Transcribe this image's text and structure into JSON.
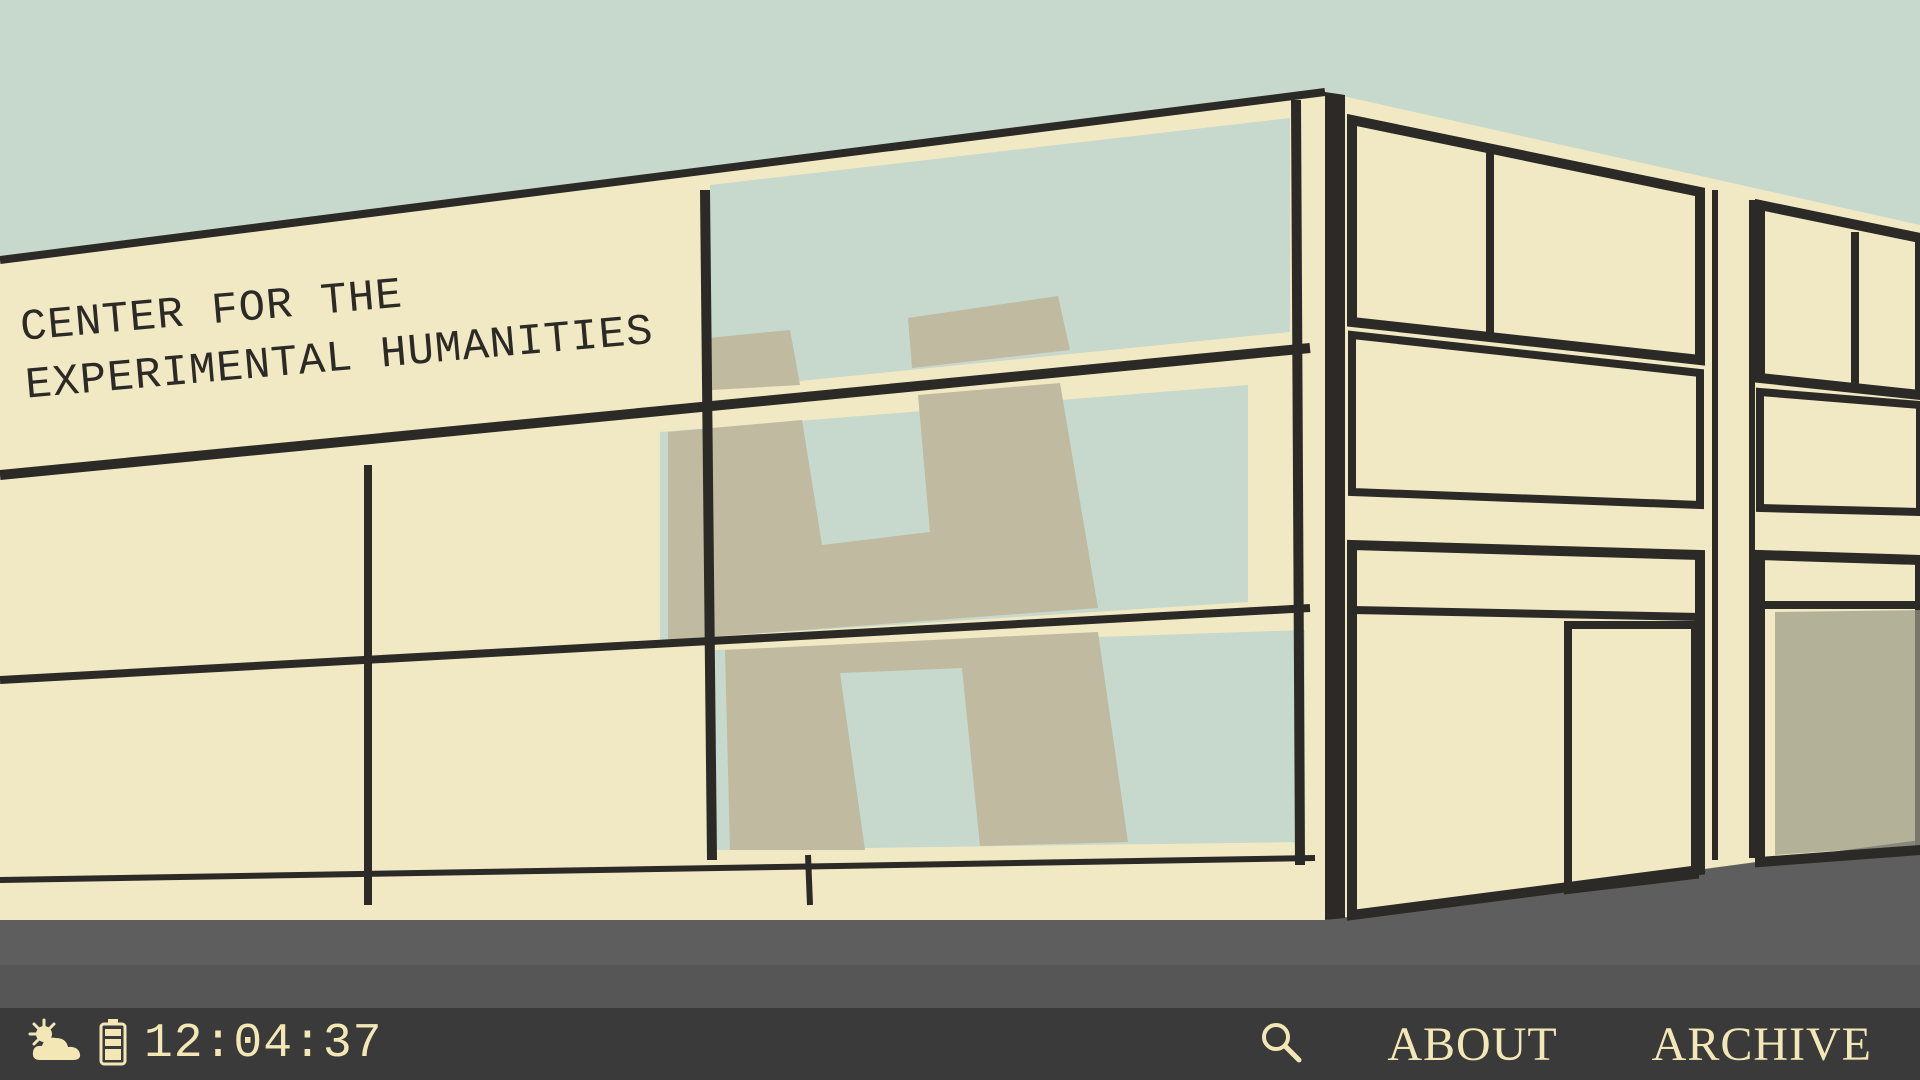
{
  "sign": {
    "line1": "CENTER FOR THE",
    "line2": "EXPERIMENTAL HUMANITIES"
  },
  "taskbar": {
    "time": "12:04:37",
    "weather_icon": "partly-cloudy-icon",
    "battery_icon": "battery-icon",
    "search_icon": "search-icon"
  },
  "nav": {
    "about": "ABOUT",
    "archive": "ARCHIVE"
  },
  "colors": {
    "sky": "#c7d8cc",
    "facade": "#f1e9c3",
    "taupe": "#bfbaa0",
    "ink": "#2b2a26",
    "road": "#5e5e5e",
    "taskbar": "#3a3a3a",
    "taskbar_text": "#f3e8b5"
  }
}
